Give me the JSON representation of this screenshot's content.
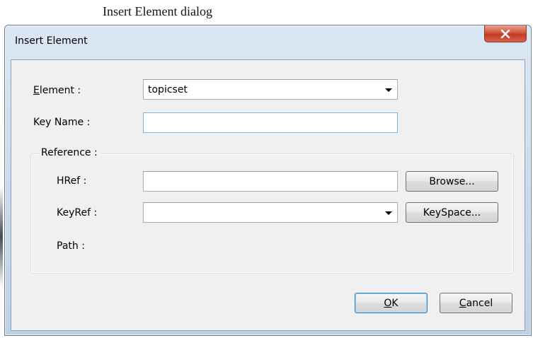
{
  "caption": "Insert Element dialog",
  "window": {
    "title": "Insert Element",
    "close_icon": "close-x-icon"
  },
  "form": {
    "element_label_accel": "E",
    "element_label_rest": "lement :",
    "element_value": "topicset",
    "key_name_label": "Key Name :",
    "key_name_value": ""
  },
  "reference": {
    "legend": "Reference :",
    "href_label": "HRef :",
    "href_value": "",
    "browse_label": "Browse...",
    "keyref_label": "KeyRef :",
    "keyref_value": "",
    "keyspace_label": "KeySpace...",
    "path_label": "Path :",
    "path_value": ""
  },
  "buttons": {
    "ok_accel": "O",
    "ok_rest": "K",
    "cancel_accel": "C",
    "cancel_rest": "ancel"
  },
  "colors": {
    "client_bg": "#f0f0f0",
    "titlebar": "#c9d9ea",
    "close": "#c23a22",
    "default_button_border": "#3c7fb1"
  }
}
